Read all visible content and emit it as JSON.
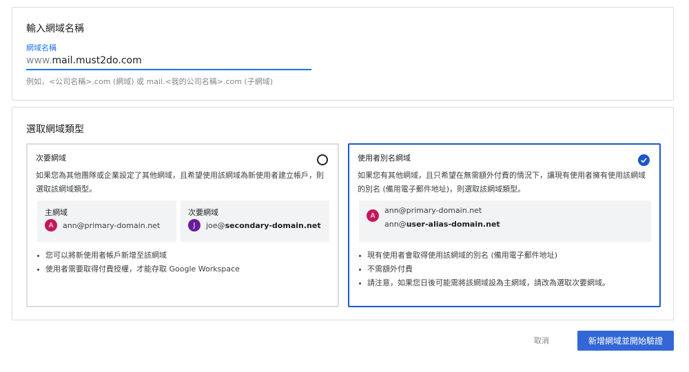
{
  "domain_section": {
    "title": "輸入網域名稱",
    "field_label": "網域名稱",
    "field_prefix": "www.",
    "field_value": "mail.must2do.com",
    "hint": "例如，<公司名稱>.com (網域) 或 mail.<我的公司名稱>.com (子網域)"
  },
  "type_section": {
    "title": "選取網域類型",
    "options": [
      {
        "title": "次要網域",
        "selected": false,
        "description": "如果您為其他團隊或企業設定了其他網域，且希望使用該網域為新使用者建立帳戶，則選取該網域類型。",
        "examples": [
          {
            "label": "主網域",
            "avatar": "A",
            "email": "ann@primary-domain.net"
          },
          {
            "label": "次要網域",
            "avatar": "J",
            "email_user": "joe@",
            "email_domain": "secondary-domain.net"
          }
        ],
        "bullets": [
          "您可以將新使用者帳戶新增至該網域",
          "使用者需要取得付費授權，才能存取 Google Workspace"
        ]
      },
      {
        "title": "使用者別名網域",
        "selected": true,
        "description": "如果您有其他網域，且只希望在無需額外付費的情況下，讓現有使用者擁有使用該網域的別名 (備用電子郵件地址)，則選取該網域類型。",
        "example": {
          "avatar": "A",
          "primary_email": "ann@primary-domain.net",
          "alias_user": "ann@",
          "alias_domain": "user-alias-domain.net"
        },
        "bullets": [
          "現有使用者會取得使用該網域的別名 (備用電子郵件地址)",
          "不需額外付費",
          "請注意，如果您日後可能需將該網域設為主網域，請改為選取次要網域。"
        ]
      }
    ]
  },
  "footer": {
    "cancel_label": "取消",
    "submit_label": "新增網域並開始驗證"
  },
  "colors": {
    "accent": "#1a73e8",
    "selected_border": "#1a57c9",
    "primary_button": "#3367d6",
    "avatar_a": "#c2185b",
    "avatar_j": "#6a1b9a"
  },
  "icons": {
    "unselected_radio": "radio-empty-icon",
    "selected_radio": "check-circle-icon"
  }
}
